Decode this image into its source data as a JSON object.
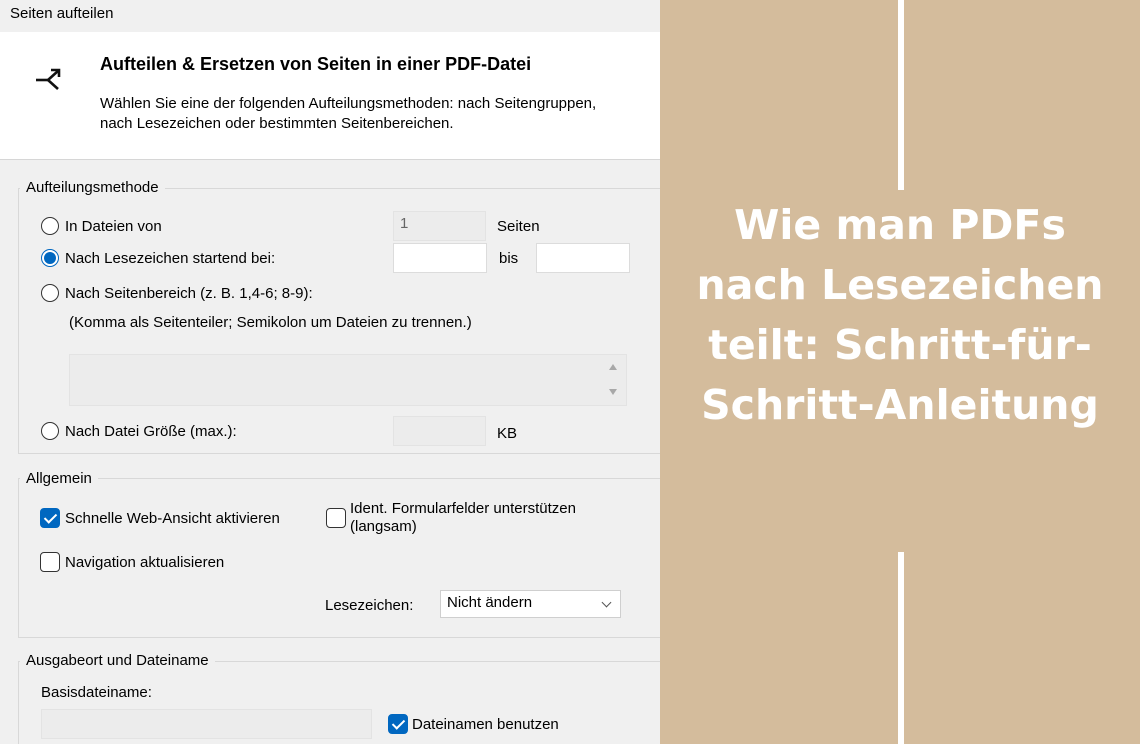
{
  "window": {
    "title": "Seiten aufteilen"
  },
  "header": {
    "icon": "split-arrow-icon",
    "title": "Aufteilen & Ersetzen von Seiten in einer PDF-Datei",
    "description_line1": "Wählen Sie eine der folgenden Aufteilungsmethoden: nach Seitengruppen,",
    "description_line2": "nach Lesezeichen oder bestimmten Seitenbereichen."
  },
  "split_method": {
    "group_title": "Aufteilungsmethode",
    "options": [
      {
        "label": "In Dateien von",
        "checked": false
      },
      {
        "label": "Nach Lesezeichen startend bei:",
        "checked": true
      },
      {
        "label": "Nach Seitenbereich (z. B. 1,4-6; 8-9):",
        "checked": false
      },
      {
        "label": "Nach Datei Größe (max.):",
        "checked": false
      }
    ],
    "pages_value": "1",
    "pages_unit": "Seiten",
    "bookmark_from_value": "",
    "bookmark_to_label": "bis",
    "bookmark_to_value": "",
    "range_hint": "(Komma als Seitenteiler; Semikolon um Dateien zu trennen.)",
    "range_value": "",
    "size_value": "",
    "size_unit": "KB"
  },
  "general": {
    "group_title": "Allgemein",
    "fast_web_view": {
      "label": "Schnelle Web-Ansicht aktivieren",
      "checked": true
    },
    "form_fields": {
      "label_line1": "Ident. Formularfelder unterstützen",
      "label_line2": "(langsam)",
      "checked": false
    },
    "update_navigation": {
      "label": "Navigation aktualisieren",
      "checked": false
    },
    "bookmarks_label": "Lesezeichen:",
    "bookmarks_selected": "Nicht ändern"
  },
  "output": {
    "group_title": "Ausgabeort und Dateiname",
    "base_filename_label": "Basisdateiname:",
    "base_filename_value": "",
    "use_filename": {
      "label": "Dateinamen benutzen",
      "checked": true
    }
  },
  "panel": {
    "title": "Wie man PDFs nach Lesezeichen teilt: Schritt-für-Schritt-Anleitung",
    "background": "#d4bc9c",
    "text_color": "#ffffff"
  }
}
